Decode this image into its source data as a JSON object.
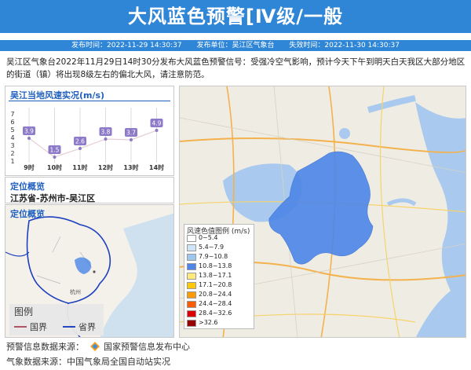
{
  "banner": {
    "title": "大风蓝色预警[Ⅳ级/一般"
  },
  "meta": {
    "publish_time": "发布时间：2022-11-29 14:30:37",
    "publish_unit": "发布单位：吴江区气象台",
    "expire_time": "失效时间：2022-11-30 14:30:37"
  },
  "description": "吴江区气象台2022年11月29日14时30分发布大风蓝色预警信号：受强冷空气影响，预计今天下午到明天白天我区大部分地区的街道（镇）将出现8级左右的偏北大风，请注意防范。",
  "wind_panel": {
    "title": "吴江当地风速实况(m/s)"
  },
  "chart_data": {
    "type": "line",
    "title": "吴江当地风速实况(m/s)",
    "categories": [
      "9时",
      "10时",
      "11时",
      "12时",
      "13时",
      "14时"
    ],
    "values": [
      3.9,
      1.5,
      2.6,
      3.8,
      3.7,
      4.9
    ],
    "yticks": [
      "1",
      "2",
      "3",
      "4",
      "5",
      "6",
      "7"
    ],
    "ylim": [
      1,
      7
    ],
    "grid": "vertical"
  },
  "location": {
    "title": "定位概览",
    "place": "江苏省-苏州市-吴江区"
  },
  "mini_map": {
    "legend_title": "图例",
    "national_border": "国界",
    "province_border": "省界",
    "city_label": "杭州"
  },
  "map_legend": {
    "title": "风速色值图例 (m/s)",
    "items": [
      {
        "label": "0~5.4",
        "color": "#ffffff"
      },
      {
        "label": "5.4~7.9",
        "color": "#cfe4f7"
      },
      {
        "label": "7.9~10.8",
        "color": "#9cc7ee"
      },
      {
        "label": "10.8~13.8",
        "color": "#4d86e8"
      },
      {
        "label": "13.8~17.1",
        "color": "#ffe97a"
      },
      {
        "label": "17.1~20.8",
        "color": "#ffc800"
      },
      {
        "label": "20.8~24.4",
        "color": "#ff9a00"
      },
      {
        "label": "24.4~28.4",
        "color": "#ff5a00"
      },
      {
        "label": "28.4~32.6",
        "color": "#e00000"
      },
      {
        "label": ">32.6",
        "color": "#990000"
      }
    ]
  },
  "sources": {
    "warning": "预警信息数据来源：",
    "warning_org": "国家预警信息发布中心",
    "weather": "气象数据来源：中国气象局全国自动站实况"
  },
  "colors": {
    "brand": "#2f86d6",
    "highlight": "#4d86e8",
    "accent": "#1f5fbf"
  }
}
